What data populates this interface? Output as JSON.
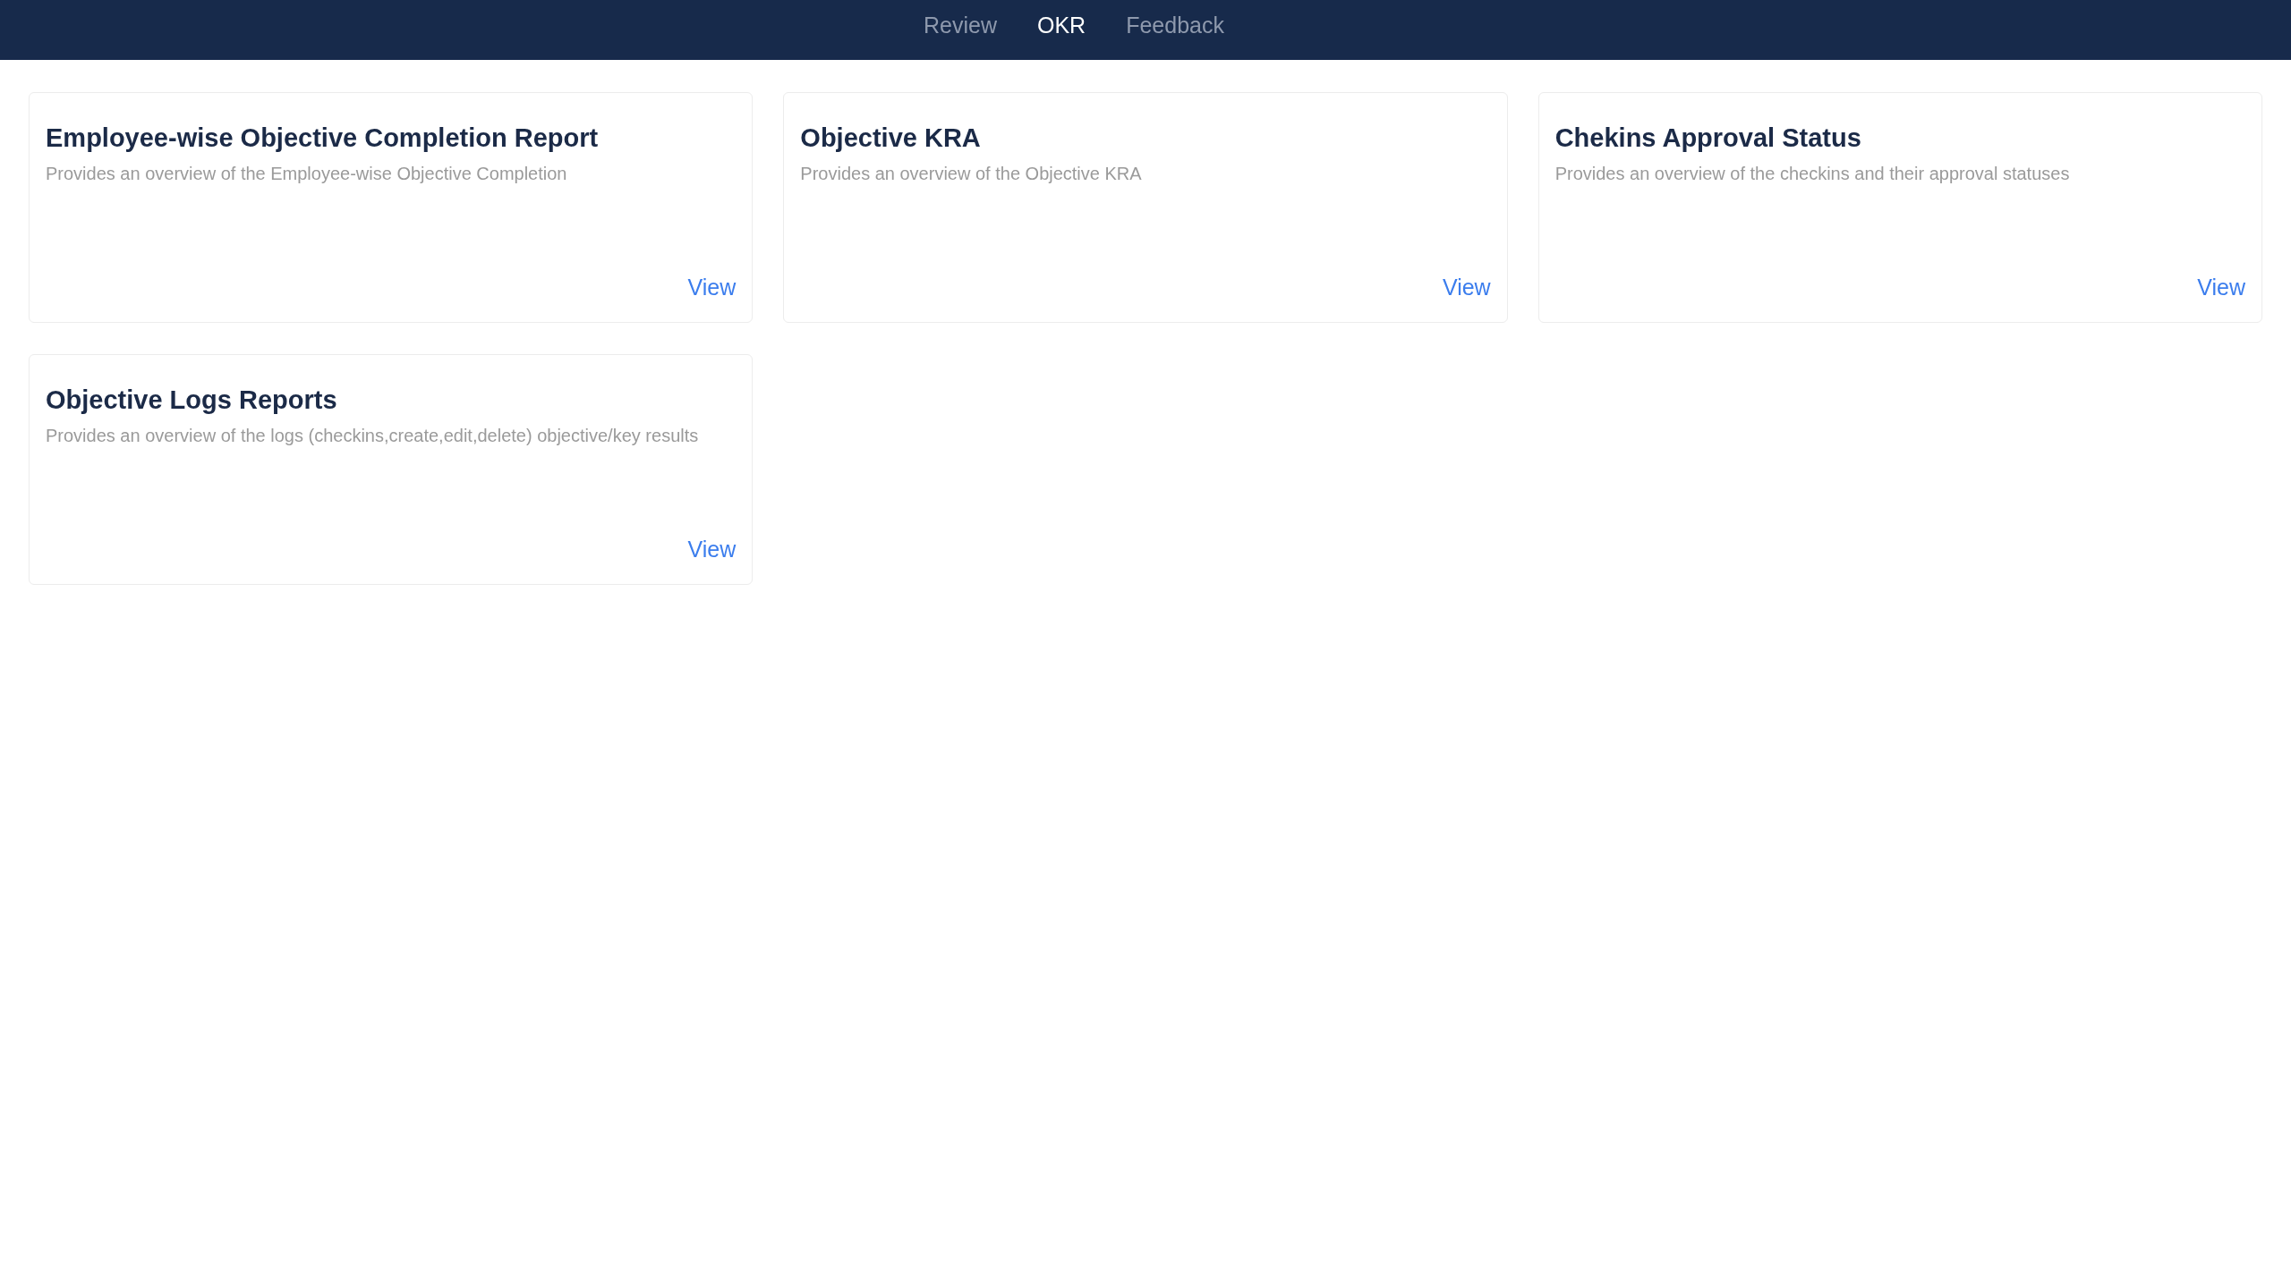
{
  "nav": {
    "tabs": [
      {
        "label": "Review",
        "selected": false
      },
      {
        "label": "OKR",
        "selected": true
      },
      {
        "label": "Feedback",
        "selected": false
      }
    ]
  },
  "reports": [
    {
      "title": "Employee-wise Objective Completion Report",
      "description": "Provides an overview of the Employee-wise Objective Completion",
      "action": "View"
    },
    {
      "title": "Objective KRA",
      "description": "Provides an overview of the Objective KRA",
      "action": "View"
    },
    {
      "title": "Chekins Approval Status",
      "description": "Provides an overview of the checkins and their approval statuses",
      "action": "View"
    },
    {
      "title": "Objective Logs Reports",
      "description": "Provides an overview of the logs (checkins,create,edit,delete) objective/key results",
      "action": "View"
    }
  ]
}
